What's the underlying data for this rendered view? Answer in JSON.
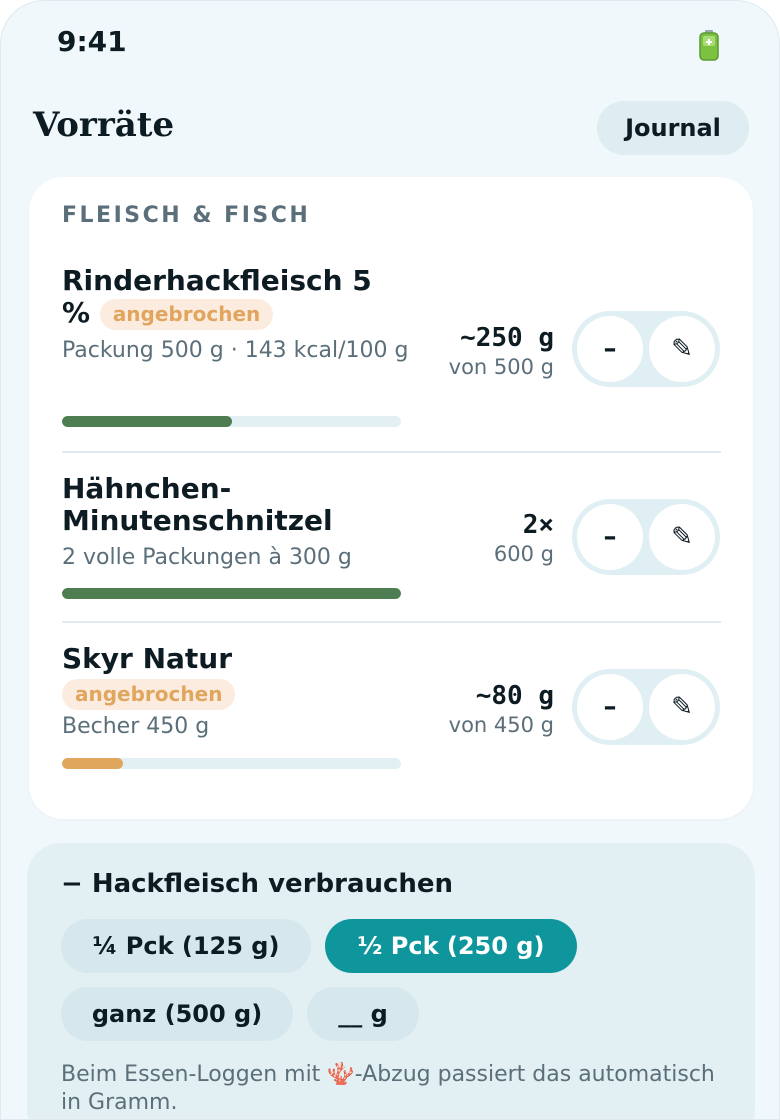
{
  "status_bar": {
    "time": "9:41",
    "battery_icon": "battery-icon"
  },
  "header": {
    "title": "Vorräte",
    "journal_label": "Journal"
  },
  "section": {
    "title": "FLEISCH & FISCH",
    "items": [
      {
        "name": "Rinderhackfleisch 5 %",
        "badge": "angebrochen",
        "sub": "Packung 500 g · 143 kcal/100 g",
        "qty_main": "~250 g",
        "qty_sub": "von 500 g",
        "fill_fraction": 0.5,
        "fill_color": "#4f7d52",
        "minus_label": "–",
        "edit_label": "✎"
      },
      {
        "name": "Hähnchen-Minutenschnitzel",
        "badge": "",
        "sub": "2 volle Packungen à 300 g",
        "qty_main": "2×",
        "qty_sub": "600 g",
        "fill_fraction": 1.0,
        "fill_color": "#4f7d52",
        "minus_label": "–",
        "edit_label": "✎"
      },
      {
        "name": "Skyr Natur",
        "badge": "angebrochen",
        "sub": "Becher 450 g",
        "qty_main": "~80 g",
        "qty_sub": "von 450 g",
        "fill_fraction": 0.18,
        "fill_color": "#e0a65e",
        "minus_label": "–",
        "edit_label": "✎"
      }
    ]
  },
  "consume": {
    "title": "− Hackfleisch verbrauchen",
    "chips": [
      {
        "label": "¼ Pck (125 g)",
        "active": false
      },
      {
        "label": "½ Pck (250 g)",
        "active": true
      },
      {
        "label": "ganz (500 g)",
        "active": false
      },
      {
        "label": "__ g",
        "active": false
      }
    ],
    "hint": "Beim Essen-Loggen mit 🪸-Abzug passiert das automatisch in Gramm."
  },
  "colors": {
    "accent": "#0e969c",
    "badge_text": "#e0a65e",
    "badge_bg": "#fcece0"
  }
}
